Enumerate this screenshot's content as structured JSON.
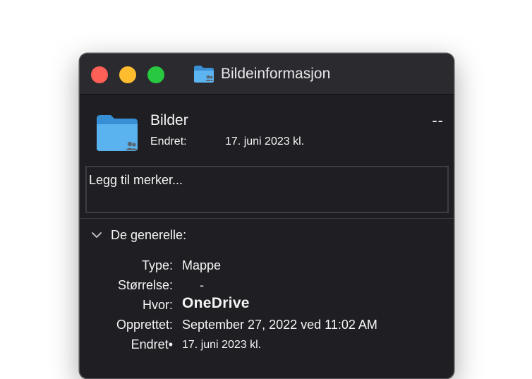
{
  "window": {
    "title": "Bildeinformasjon",
    "title_icon": "folder-shared-icon"
  },
  "header": {
    "name": "Bilder",
    "size": "--",
    "modified_label": "Endret:",
    "modified_value": "17. juni 2023 kl.",
    "icon": "folder-shared-icon"
  },
  "tags": {
    "placeholder": "Legg til merker..."
  },
  "general": {
    "title": "De generelle:",
    "rows": [
      {
        "label": "Type:",
        "value": "Mappe"
      },
      {
        "label": "Størrelse:",
        "value": "-"
      },
      {
        "label": "Hvor:",
        "value": "OneDrive"
      },
      {
        "label": "Opprettet:",
        "value": "September 27, 2022 ved 11:02 AM"
      },
      {
        "label": "Endret•",
        "value": "17. juni 2023 kl."
      }
    ]
  },
  "colors": {
    "close": "#fe5f57",
    "minimize": "#febc2e",
    "zoom": "#28c840",
    "folder": "#4aa6e8"
  }
}
